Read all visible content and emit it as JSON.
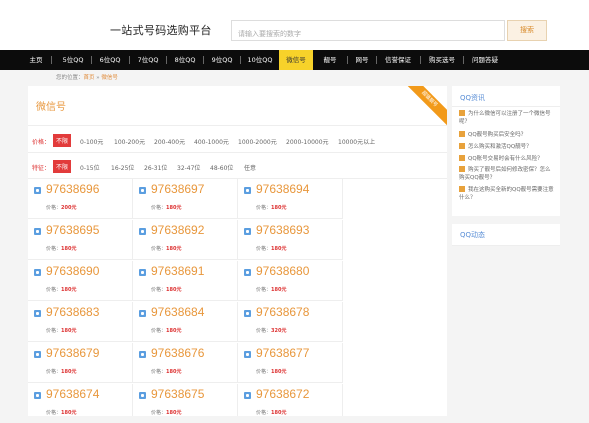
{
  "header": {
    "site_title": "一站式号码选购平台",
    "search_placeholder": "请输入要搜索的数字",
    "search_button": "搜索"
  },
  "nav": {
    "items": [
      {
        "label": "主页"
      },
      {
        "label": "5位QQ"
      },
      {
        "label": "6位QQ"
      },
      {
        "label": "7位QQ"
      },
      {
        "label": "8位QQ"
      },
      {
        "label": "9位QQ"
      },
      {
        "label": "10位QQ"
      },
      {
        "label": "微信号"
      },
      {
        "label": "靓号"
      },
      {
        "label": "网号"
      },
      {
        "label": "信誉保证"
      },
      {
        "label": "购买选号"
      },
      {
        "label": "问题答疑"
      }
    ],
    "active_index": 7
  },
  "breadcrumb": {
    "prefix": "您的位置：",
    "home": "首页",
    "sep": " » ",
    "current": "微信号"
  },
  "main": {
    "title": "微信号",
    "ribbon": "超值靓号",
    "price_filter": {
      "label": "价格：",
      "options": [
        "不限",
        "0-100元",
        "100-200元",
        "200-400元",
        "400-1000元",
        "1000-2000元",
        "2000-10000元",
        "10000元以上"
      ]
    },
    "type_filter": {
      "label": "特征：",
      "options": [
        "不限",
        "0-15位",
        "16-25位",
        "26-31位",
        "32-47位",
        "48-60位",
        "任意"
      ]
    },
    "price_prefix": "价格：",
    "cards": [
      {
        "number": "97638696",
        "price": "200元"
      },
      {
        "number": "97638697",
        "price": "180元"
      },
      {
        "number": "97638694",
        "price": "180元"
      },
      {
        "number": "97638695",
        "price": "180元"
      },
      {
        "number": "97638692",
        "price": "180元"
      },
      {
        "number": "97638693",
        "price": "180元"
      },
      {
        "number": "97638690",
        "price": "180元"
      },
      {
        "number": "97638691",
        "price": "180元"
      },
      {
        "number": "97638680",
        "price": "180元"
      },
      {
        "number": "97638683",
        "price": "180元"
      },
      {
        "number": "97638684",
        "price": "180元"
      },
      {
        "number": "97638678",
        "price": "320元"
      },
      {
        "number": "97638679",
        "price": "180元"
      },
      {
        "number": "97638676",
        "price": "180元"
      },
      {
        "number": "97638677",
        "price": "180元"
      },
      {
        "number": "97638674",
        "price": "180元"
      },
      {
        "number": "97638675",
        "price": "180元"
      },
      {
        "number": "97638672",
        "price": "180元"
      }
    ]
  },
  "sidebar": {
    "qq_news_title": "QQ资讯",
    "news": [
      "为什么微信可以注册了一个微信号呢？",
      "QQ靓号购买后安全吗？",
      "怎么购买和激活QQ靓号？",
      "QQ账号交易时会有什么风险？",
      "购买了靓号后如何修改密保？怎么购买QQ靓号？",
      "我在这购买全新的QQ靓号需要注意什么？"
    ],
    "qq_dynamic_title": "QQ动态"
  }
}
